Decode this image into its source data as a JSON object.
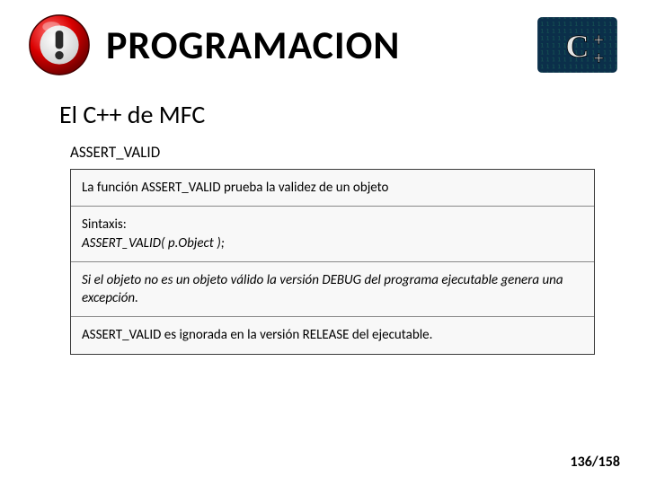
{
  "header": {
    "alert_icon_name": "alert-icon",
    "title": "PROGRAMACION",
    "cpp_logo_name": "cpp-logo"
  },
  "subtitle": "El C++ de MFC",
  "section_label": "ASSERT_VALID",
  "box": {
    "r1": "La función ASSERT_VALID prueba la validez de un objeto",
    "r2_label": "Sintaxis:",
    "r2_code": "ASSERT_VALID( p.Object );",
    "r3": "Si el objeto no es un objeto válido la versión DEBUG del programa ejecutable genera una excepción.",
    "r4": "ASSERT_VALID es ignorada en la versión RELEASE del ejecutable."
  },
  "page_number": "136/158"
}
